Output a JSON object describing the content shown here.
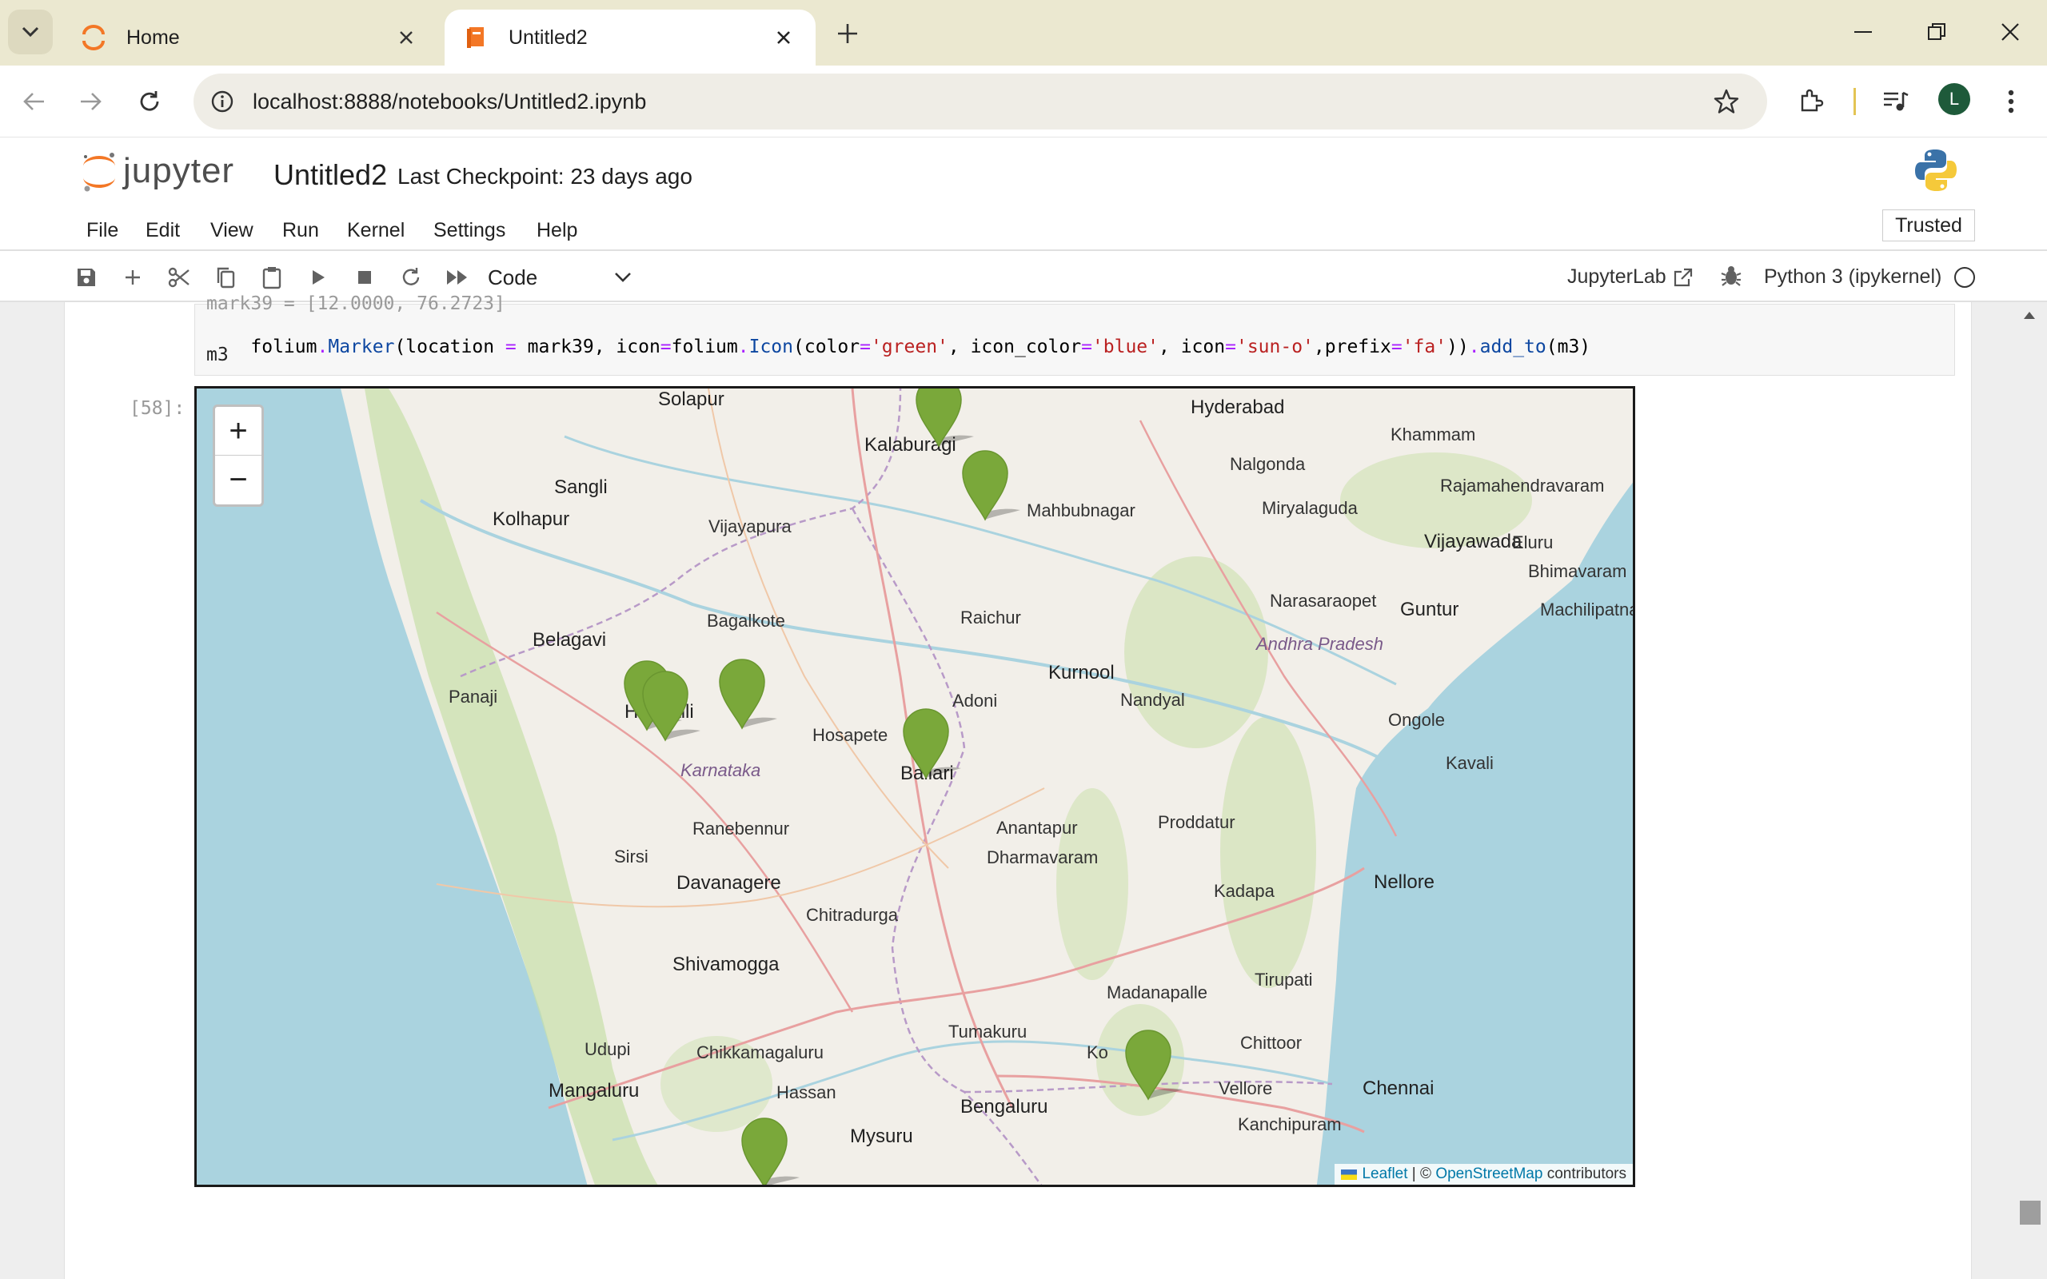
{
  "browser": {
    "tabs": [
      {
        "label": "Home",
        "active": false
      },
      {
        "label": "Untitled2",
        "active": true
      }
    ],
    "url": "localhost:8888/notebooks/Untitled2.ipynb",
    "profile_initial": "L"
  },
  "jupyter": {
    "logo_text": "jupyter",
    "notebook_name": "Untitled2",
    "checkpoint": "Last Checkpoint: 23 days ago",
    "menu": [
      "File",
      "Edit",
      "View",
      "Run",
      "Kernel",
      "Settings",
      "Help"
    ],
    "trusted": "Trusted",
    "cell_type": "Code",
    "jupyterlab_label": "JupyterLab",
    "kernel_name": "Python 3 (ipykernel)"
  },
  "cell": {
    "code_partial": "mark39 = [12.0000, 76.2723]",
    "code_lines": [
      {
        "parts": [
          "folium",
          ".",
          "Marker",
          "(location ",
          "=",
          " mark39, icon",
          "=",
          "folium",
          ".",
          "Icon",
          "(color",
          "=",
          "'green'",
          ", icon_color",
          "=",
          "'blue'",
          ", icon",
          "=",
          "'sun-o'",
          ",prefix",
          "=",
          "'fa'",
          "))",
          ".",
          "add_to",
          "(m3)"
        ]
      },
      {
        "parts": [
          "m3"
        ]
      }
    ],
    "out_prompt": "[58]:"
  },
  "map": {
    "zoom_in": "+",
    "zoom_out": "−",
    "attribution": {
      "leaflet": "Leaflet",
      "sep": " | © ",
      "osm": "OpenStreetMap",
      "tail": " contributors"
    },
    "places": [
      {
        "name": "Solapur",
        "cls": "big"
      },
      {
        "name": "Hyderabad",
        "cls": "big"
      },
      {
        "name": "Khammam",
        "cls": ""
      },
      {
        "name": "Kalaburagi",
        "cls": "big"
      },
      {
        "name": "Nalgonda",
        "cls": ""
      },
      {
        "name": "Rajamahendravaram",
        "cls": ""
      },
      {
        "name": "Sangli",
        "cls": "big"
      },
      {
        "name": "Mahbubnagar",
        "cls": ""
      },
      {
        "name": "Miryalaguda",
        "cls": ""
      },
      {
        "name": "Kolhapur",
        "cls": "big"
      },
      {
        "name": "Vijayapura",
        "cls": ""
      },
      {
        "name": "Vijayawada",
        "cls": "big"
      },
      {
        "name": "Eluru",
        "cls": ""
      },
      {
        "name": "Bhimavaram",
        "cls": ""
      },
      {
        "name": "Raichur",
        "cls": ""
      },
      {
        "name": "Narasaraopet",
        "cls": ""
      },
      {
        "name": "Guntur",
        "cls": "big"
      },
      {
        "name": "Machilipatnam",
        "cls": ""
      },
      {
        "name": "Bagalkote",
        "cls": ""
      },
      {
        "name": "Belagavi",
        "cls": "big"
      },
      {
        "name": "Andhra Pradesh",
        "cls": "state"
      },
      {
        "name": "Kurnool",
        "cls": "big"
      },
      {
        "name": "Panaji",
        "cls": ""
      },
      {
        "name": "Hubballi",
        "cls": "big"
      },
      {
        "name": "Adoni",
        "cls": ""
      },
      {
        "name": "Nandyal",
        "cls": ""
      },
      {
        "name": "Ongole",
        "cls": ""
      },
      {
        "name": "Hosapete",
        "cls": ""
      },
      {
        "name": "Karnataka",
        "cls": "state"
      },
      {
        "name": "Ballari",
        "cls": "big"
      },
      {
        "name": "Kavali",
        "cls": ""
      },
      {
        "name": "Ranebennur",
        "cls": ""
      },
      {
        "name": "Anantapur",
        "cls": ""
      },
      {
        "name": "Proddatur",
        "cls": ""
      },
      {
        "name": "Sirsi",
        "cls": ""
      },
      {
        "name": "Dharmavaram",
        "cls": ""
      },
      {
        "name": "Davanagere",
        "cls": "big"
      },
      {
        "name": "Kadapa",
        "cls": ""
      },
      {
        "name": "Nellore",
        "cls": "big"
      },
      {
        "name": "Chitradurga",
        "cls": ""
      },
      {
        "name": "Shivamogga",
        "cls": "big"
      },
      {
        "name": "Tirupati",
        "cls": ""
      },
      {
        "name": "Madanapalle",
        "cls": ""
      },
      {
        "name": "Tumakuru",
        "cls": ""
      },
      {
        "name": "Udupi",
        "cls": ""
      },
      {
        "name": "Chittoor",
        "cls": ""
      },
      {
        "name": "Chikkamagaluru",
        "cls": ""
      },
      {
        "name": "Ko",
        "cls": ""
      },
      {
        "name": "Vellore",
        "cls": ""
      },
      {
        "name": "Mangaluru",
        "cls": "big"
      },
      {
        "name": "Hassan",
        "cls": ""
      },
      {
        "name": "Chennai",
        "cls": "big"
      },
      {
        "name": "Bengaluru",
        "cls": "big"
      },
      {
        "name": "Kanchipuram",
        "cls": ""
      },
      {
        "name": "Mysuru",
        "cls": "big"
      }
    ],
    "marker_color": "#7aa83a",
    "marker_count": 10
  },
  "colors": {
    "tabbar": "#ebe8d0",
    "jupyter_orange": "#f37726",
    "sea": "#aad3df",
    "land": "#f2efe9",
    "forest": "#c8dfa8"
  }
}
